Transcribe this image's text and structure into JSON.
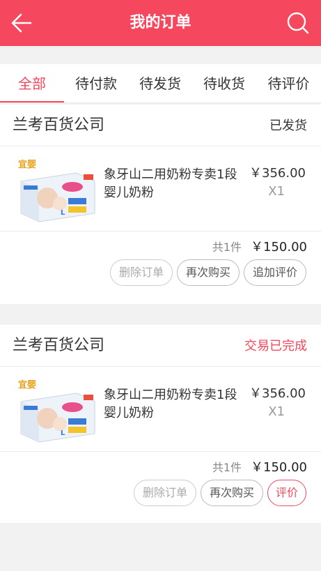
{
  "header": {
    "title": "我的订单",
    "bg_color": "#f5475d",
    "back_icon": "arrow-left-icon",
    "search_icon": "search-icon"
  },
  "tabs": [
    {
      "label": "全部",
      "active": true
    },
    {
      "label": "待付款",
      "active": false
    },
    {
      "label": "待发货",
      "active": false
    },
    {
      "label": "待收货",
      "active": false
    },
    {
      "label": "待评价",
      "active": false
    }
  ],
  "orders": [
    {
      "shop": "兰考百货公司",
      "status": "已发货",
      "item": {
        "brand": "宜婴",
        "name": "象牙山二用奶粉专卖1段婴儿奶粉",
        "price": "￥356.00",
        "qty": "X1"
      },
      "count": "共1件",
      "total": "￥150.00",
      "actions": [
        "删除订单",
        "再次购买",
        "追加评价"
      ]
    },
    {
      "shop": "兰考百货公司",
      "status": "交易已完成",
      "item": {
        "brand": "宜婴",
        "name": "象牙山二用奶粉专卖1段婴儿奶粉",
        "price": "￥356.00",
        "qty": "X1"
      },
      "count": "共1件",
      "total": "￥150.00",
      "actions": [
        "删除订单",
        "再次购买",
        "评价"
      ]
    }
  ],
  "accent_color": "#f5475d"
}
